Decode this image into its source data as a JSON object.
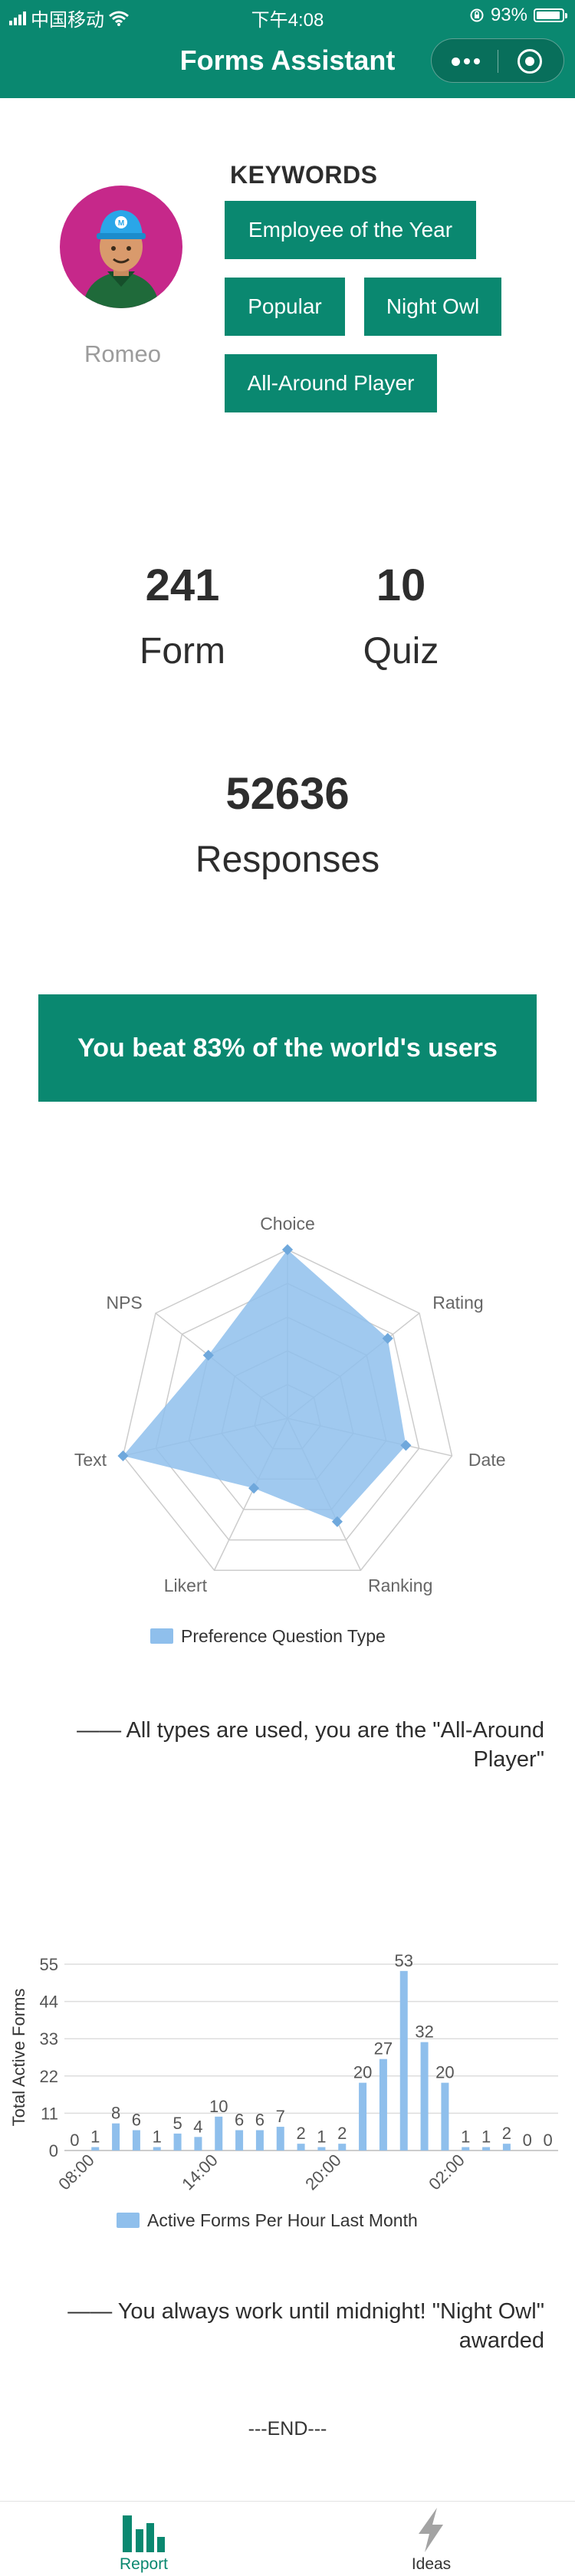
{
  "status_bar": {
    "carrier": "中国移动",
    "time": "下午4:08",
    "battery": "93%"
  },
  "nav": {
    "title": "Forms Assistant",
    "more_icon": "more-dots-icon",
    "close_icon": "target-circle-icon"
  },
  "profile": {
    "username": "Romeo",
    "keywords_title": "KEYWORDS",
    "keywords": [
      "Employee of the Year",
      "Popular",
      "Night Owl",
      "All-Around Player"
    ]
  },
  "stats": {
    "forms_value": "241",
    "forms_label": "Form",
    "quiz_value": "10",
    "quiz_label": "Quiz",
    "responses_value": "52636",
    "responses_label": "Responses"
  },
  "banner": {
    "text": "You beat 83% of the world's users"
  },
  "radar_comment": "—— All types are used, you are the \"All-Around Player\"",
  "bar_comment": "—— You always work until midnight! \"Night Owl\" awarded",
  "end_text": "---END---",
  "tabs": [
    {
      "label": "Report",
      "icon": "bar-chart-icon",
      "active": true
    },
    {
      "label": "Ideas",
      "icon": "lightning-icon",
      "active": false
    }
  ],
  "colors": {
    "brand": "#0a8870",
    "chart_fill": "#8fbfec",
    "chart_point": "#6fa8dc",
    "tab_inactive": "#9e9e9e"
  },
  "chart_data": [
    {
      "type": "radar",
      "axes": [
        "Choice",
        "Rating",
        "Date",
        "Ranking",
        "Likert",
        "Text",
        "NPS"
      ],
      "max": 100,
      "legend": "Preference Question Type",
      "series": [
        {
          "name": "Preference Question Type",
          "values": [
            100,
            76,
            72,
            68,
            46,
            100,
            60
          ]
        }
      ]
    },
    {
      "type": "bar",
      "ylabel": "Total Active Forms",
      "legend": "Active Forms Per Hour Last Month",
      "yticks": [
        0,
        11,
        22,
        33,
        44,
        55
      ],
      "ylim": [
        0,
        55
      ],
      "xtick_labels": [
        "08:00",
        "14:00",
        "20:00",
        "02:00"
      ],
      "categories": [
        "07:00",
        "08:00",
        "09:00",
        "10:00",
        "11:00",
        "12:00",
        "13:00",
        "14:00",
        "15:00",
        "16:00",
        "17:00",
        "18:00",
        "19:00",
        "20:00",
        "21:00",
        "22:00",
        "23:00",
        "00:00",
        "01:00",
        "02:00",
        "03:00",
        "04:00",
        "05:00",
        "06:00"
      ],
      "values": [
        0,
        1,
        8,
        6,
        1,
        5,
        4,
        10,
        6,
        6,
        7,
        2,
        1,
        2,
        20,
        27,
        53,
        32,
        20,
        1,
        1,
        2,
        0,
        0
      ],
      "series": [
        {
          "name": "Active Forms Per Hour Last Month",
          "values": [
            0,
            1,
            8,
            6,
            1,
            5,
            4,
            10,
            6,
            6,
            7,
            2,
            1,
            2,
            20,
            27,
            53,
            32,
            20,
            1,
            1,
            2,
            0,
            0
          ]
        }
      ]
    }
  ]
}
